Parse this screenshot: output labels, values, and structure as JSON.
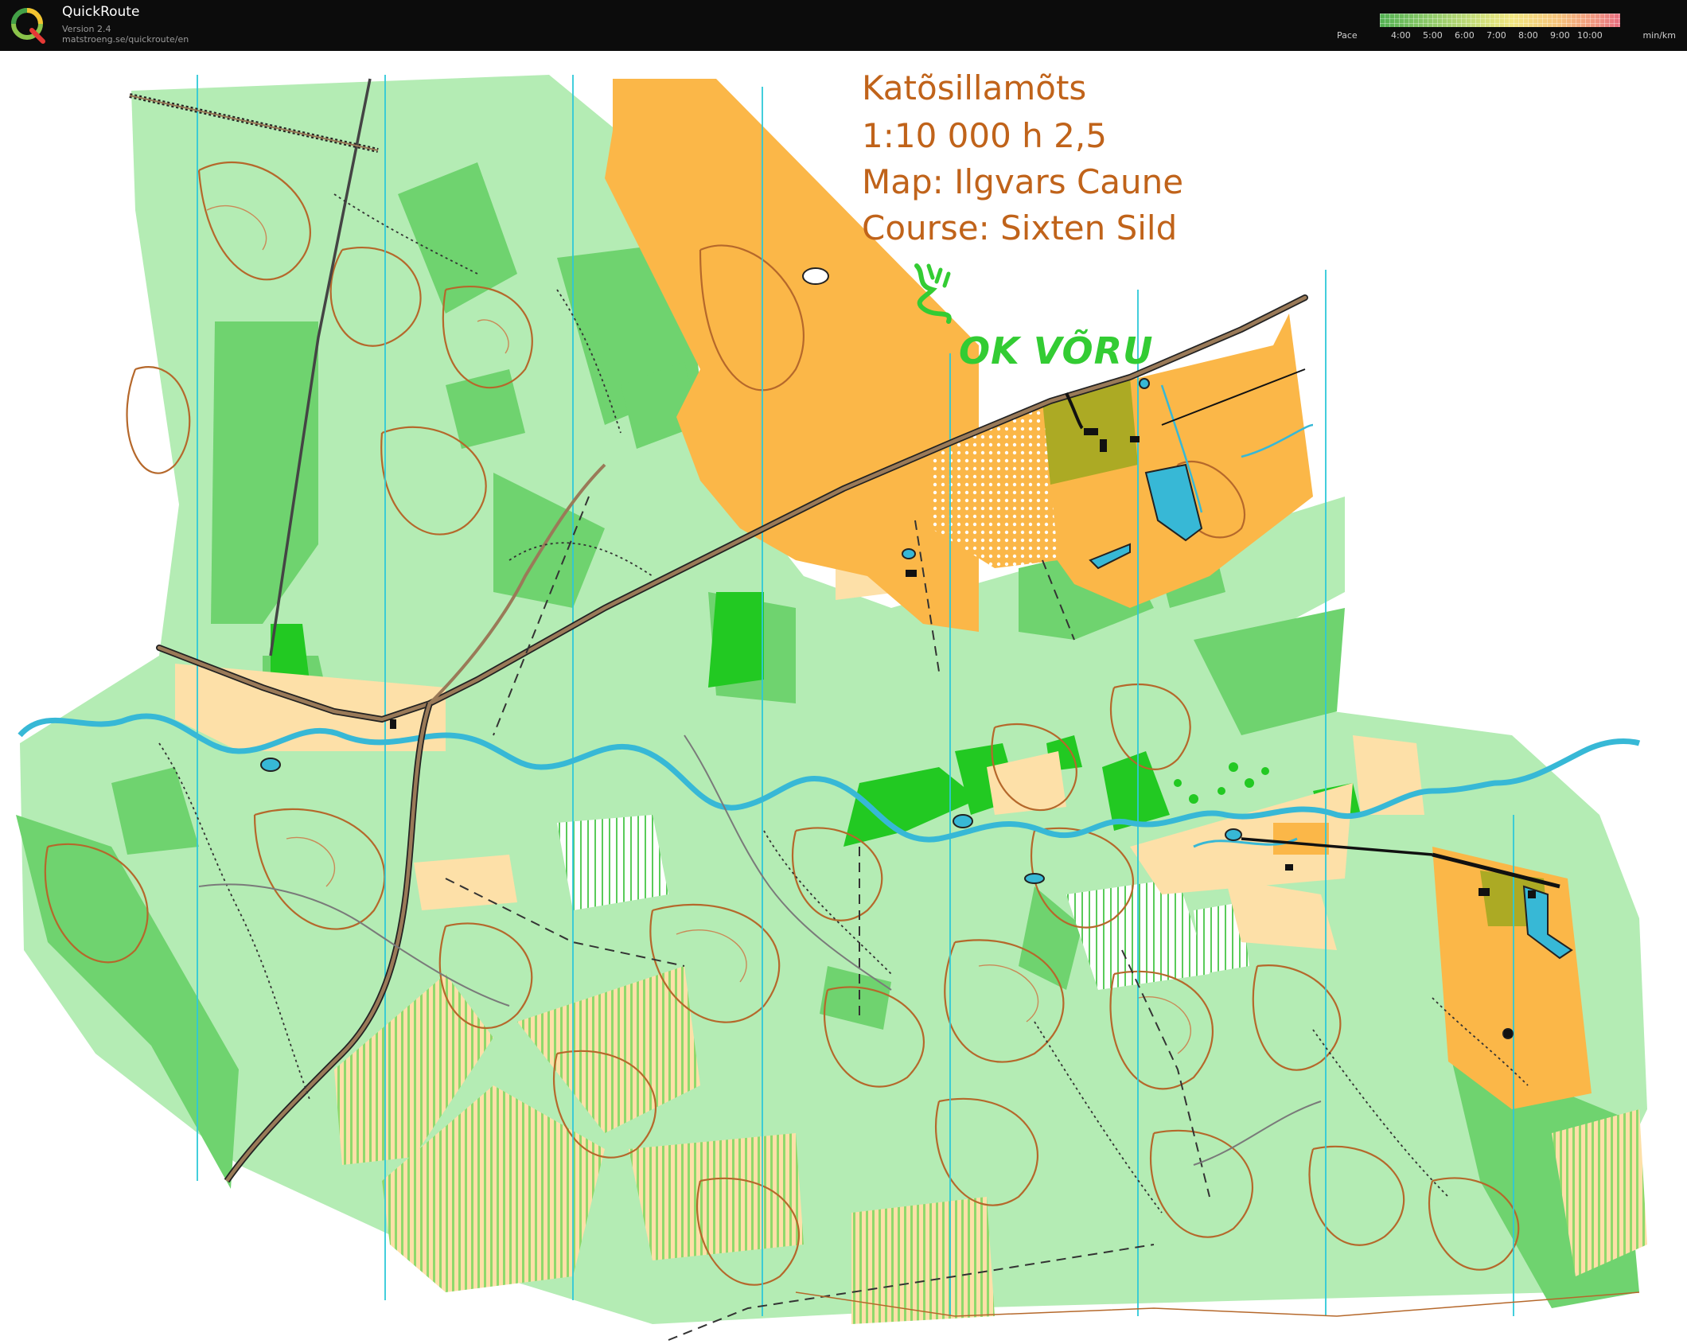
{
  "app": {
    "name": "QuickRoute",
    "version": "Version 2.4",
    "url": "matstroeng.se/quickroute/en",
    "logo_letter": "Q"
  },
  "pace_legend": {
    "label": "Pace",
    "unit": "min/km",
    "ticks": [
      "4:00",
      "5:00",
      "6:00",
      "7:00",
      "8:00",
      "9:00",
      "10:00"
    ]
  },
  "map": {
    "title_lines": [
      "Katõsillamõts",
      "1:10 000 h 2,5",
      "Map: Ilgvars Caune",
      "Course: Sixten Sild"
    ],
    "club_logo": "OK VÕRU",
    "title_color": "#c0631a",
    "colors": {
      "forest_green": "#6fd36f",
      "light_green": "#b4ecb4",
      "dark_green": "#22c922",
      "open_land": "#fbb748",
      "rough_open": "#fde0a8",
      "water": "#37b8d6",
      "contours": "#b5682b",
      "roads": "#9a7a58",
      "magnetic_north_lines": "#2ec8d8"
    }
  }
}
